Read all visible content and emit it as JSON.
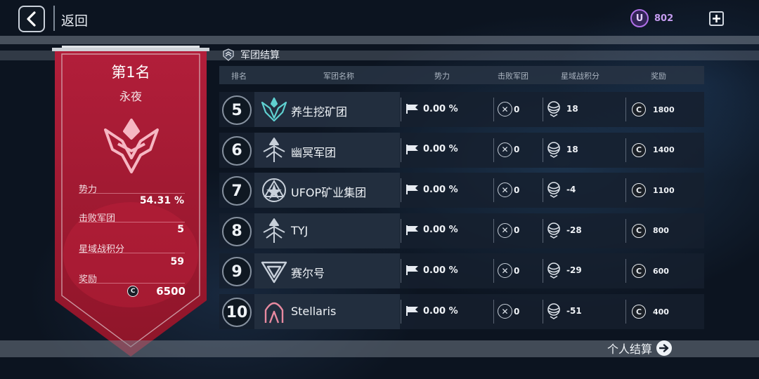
{
  "nav": {
    "back_label": "返回"
  },
  "currency": {
    "icon_letter": "U",
    "amount": "802",
    "icon": "u-coin-icon",
    "add_icon": "plus-icon"
  },
  "section": {
    "title": "军团结算",
    "icon": "legion-badge-icon"
  },
  "banner": {
    "rank_title": "第1名",
    "legion_name": "永夜",
    "emblem": "crimson-crown-emblem",
    "stats": {
      "power_label": "势力",
      "power_value": "54.31 %",
      "defeated_label": "击败军团",
      "defeated_value": "5",
      "score_label": "星域战积分",
      "score_value": "59",
      "reward_label": "奖励",
      "reward_value": "6500"
    },
    "color": "#a61c35"
  },
  "table": {
    "headers": {
      "rank": "排名",
      "name": "军团名称",
      "power": "势力",
      "defeated": "击败军团",
      "score": "星域战积分",
      "reward": "奖励"
    },
    "rows": [
      {
        "rank": "5",
        "name": "养生挖矿团",
        "icon": "teal-winged-emblem",
        "power": "0.00 %",
        "defeated": "0",
        "score": "18",
        "reward": "1800"
      },
      {
        "rank": "6",
        "name": "幽冥军团",
        "icon": "silver-arrow-emblem",
        "power": "0.00 %",
        "defeated": "0",
        "score": "18",
        "reward": "1400"
      },
      {
        "rank": "7",
        "name": "UFOP矿业集团",
        "icon": "silver-triangle-star-emblem",
        "power": "0.00 %",
        "defeated": "0",
        "score": "-4",
        "reward": "1100"
      },
      {
        "rank": "8",
        "name": "TYJ",
        "icon": "silver-arrow-emblem",
        "power": "0.00 %",
        "defeated": "0",
        "score": "-28",
        "reward": "800"
      },
      {
        "rank": "9",
        "name": "赛尔号",
        "icon": "silver-chevron-emblem",
        "power": "0.00 %",
        "defeated": "0",
        "score": "-29",
        "reward": "600"
      },
      {
        "rank": "10",
        "name": "Stellaris",
        "icon": "pink-arch-emblem",
        "power": "0.00 %",
        "defeated": "0",
        "score": "-51",
        "reward": "400"
      }
    ]
  },
  "footer": {
    "personal_label": "个人结算",
    "arrow_icon": "arrow-right-icon"
  },
  "colors": {
    "accent_purple": "#b070e8",
    "banner_red": "#a61c35",
    "teal": "#5fd0d0",
    "pink": "#e88aa0"
  }
}
